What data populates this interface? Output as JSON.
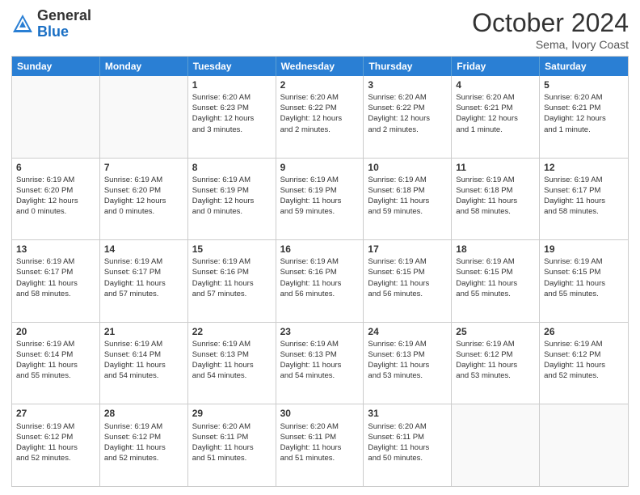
{
  "header": {
    "logo": {
      "general": "General",
      "blue": "Blue"
    },
    "month": "October 2024",
    "location": "Sema, Ivory Coast"
  },
  "days_of_week": [
    "Sunday",
    "Monday",
    "Tuesday",
    "Wednesday",
    "Thursday",
    "Friday",
    "Saturday"
  ],
  "weeks": [
    [
      {
        "day": "",
        "info": ""
      },
      {
        "day": "",
        "info": ""
      },
      {
        "day": "1",
        "info": "Sunrise: 6:20 AM\nSunset: 6:23 PM\nDaylight: 12 hours\nand 3 minutes."
      },
      {
        "day": "2",
        "info": "Sunrise: 6:20 AM\nSunset: 6:22 PM\nDaylight: 12 hours\nand 2 minutes."
      },
      {
        "day": "3",
        "info": "Sunrise: 6:20 AM\nSunset: 6:22 PM\nDaylight: 12 hours\nand 2 minutes."
      },
      {
        "day": "4",
        "info": "Sunrise: 6:20 AM\nSunset: 6:21 PM\nDaylight: 12 hours\nand 1 minute."
      },
      {
        "day": "5",
        "info": "Sunrise: 6:20 AM\nSunset: 6:21 PM\nDaylight: 12 hours\nand 1 minute."
      }
    ],
    [
      {
        "day": "6",
        "info": "Sunrise: 6:19 AM\nSunset: 6:20 PM\nDaylight: 12 hours\nand 0 minutes."
      },
      {
        "day": "7",
        "info": "Sunrise: 6:19 AM\nSunset: 6:20 PM\nDaylight: 12 hours\nand 0 minutes."
      },
      {
        "day": "8",
        "info": "Sunrise: 6:19 AM\nSunset: 6:19 PM\nDaylight: 12 hours\nand 0 minutes."
      },
      {
        "day": "9",
        "info": "Sunrise: 6:19 AM\nSunset: 6:19 PM\nDaylight: 11 hours\nand 59 minutes."
      },
      {
        "day": "10",
        "info": "Sunrise: 6:19 AM\nSunset: 6:18 PM\nDaylight: 11 hours\nand 59 minutes."
      },
      {
        "day": "11",
        "info": "Sunrise: 6:19 AM\nSunset: 6:18 PM\nDaylight: 11 hours\nand 58 minutes."
      },
      {
        "day": "12",
        "info": "Sunrise: 6:19 AM\nSunset: 6:17 PM\nDaylight: 11 hours\nand 58 minutes."
      }
    ],
    [
      {
        "day": "13",
        "info": "Sunrise: 6:19 AM\nSunset: 6:17 PM\nDaylight: 11 hours\nand 58 minutes."
      },
      {
        "day": "14",
        "info": "Sunrise: 6:19 AM\nSunset: 6:17 PM\nDaylight: 11 hours\nand 57 minutes."
      },
      {
        "day": "15",
        "info": "Sunrise: 6:19 AM\nSunset: 6:16 PM\nDaylight: 11 hours\nand 57 minutes."
      },
      {
        "day": "16",
        "info": "Sunrise: 6:19 AM\nSunset: 6:16 PM\nDaylight: 11 hours\nand 56 minutes."
      },
      {
        "day": "17",
        "info": "Sunrise: 6:19 AM\nSunset: 6:15 PM\nDaylight: 11 hours\nand 56 minutes."
      },
      {
        "day": "18",
        "info": "Sunrise: 6:19 AM\nSunset: 6:15 PM\nDaylight: 11 hours\nand 55 minutes."
      },
      {
        "day": "19",
        "info": "Sunrise: 6:19 AM\nSunset: 6:15 PM\nDaylight: 11 hours\nand 55 minutes."
      }
    ],
    [
      {
        "day": "20",
        "info": "Sunrise: 6:19 AM\nSunset: 6:14 PM\nDaylight: 11 hours\nand 55 minutes."
      },
      {
        "day": "21",
        "info": "Sunrise: 6:19 AM\nSunset: 6:14 PM\nDaylight: 11 hours\nand 54 minutes."
      },
      {
        "day": "22",
        "info": "Sunrise: 6:19 AM\nSunset: 6:13 PM\nDaylight: 11 hours\nand 54 minutes."
      },
      {
        "day": "23",
        "info": "Sunrise: 6:19 AM\nSunset: 6:13 PM\nDaylight: 11 hours\nand 54 minutes."
      },
      {
        "day": "24",
        "info": "Sunrise: 6:19 AM\nSunset: 6:13 PM\nDaylight: 11 hours\nand 53 minutes."
      },
      {
        "day": "25",
        "info": "Sunrise: 6:19 AM\nSunset: 6:12 PM\nDaylight: 11 hours\nand 53 minutes."
      },
      {
        "day": "26",
        "info": "Sunrise: 6:19 AM\nSunset: 6:12 PM\nDaylight: 11 hours\nand 52 minutes."
      }
    ],
    [
      {
        "day": "27",
        "info": "Sunrise: 6:19 AM\nSunset: 6:12 PM\nDaylight: 11 hours\nand 52 minutes."
      },
      {
        "day": "28",
        "info": "Sunrise: 6:19 AM\nSunset: 6:12 PM\nDaylight: 11 hours\nand 52 minutes."
      },
      {
        "day": "29",
        "info": "Sunrise: 6:20 AM\nSunset: 6:11 PM\nDaylight: 11 hours\nand 51 minutes."
      },
      {
        "day": "30",
        "info": "Sunrise: 6:20 AM\nSunset: 6:11 PM\nDaylight: 11 hours\nand 51 minutes."
      },
      {
        "day": "31",
        "info": "Sunrise: 6:20 AM\nSunset: 6:11 PM\nDaylight: 11 hours\nand 50 minutes."
      },
      {
        "day": "",
        "info": ""
      },
      {
        "day": "",
        "info": ""
      }
    ]
  ]
}
